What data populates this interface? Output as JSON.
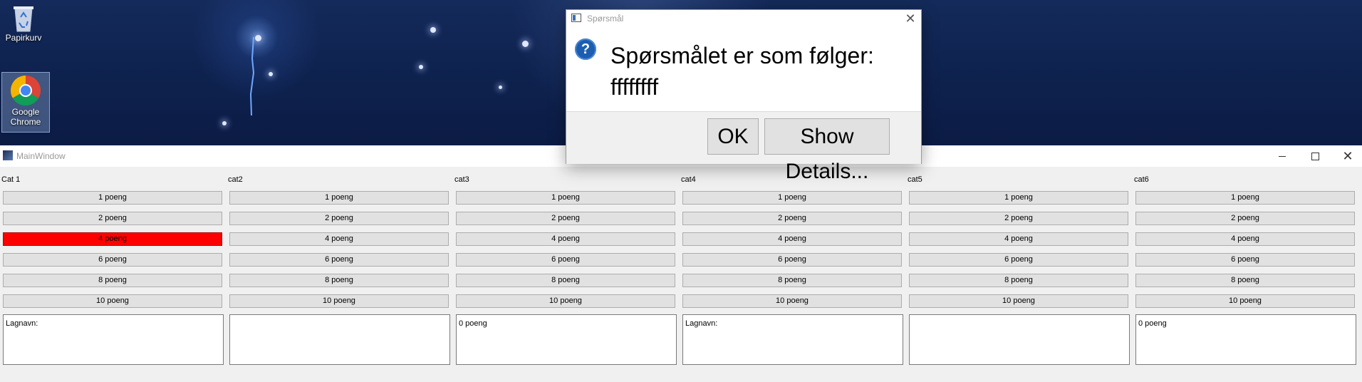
{
  "desktop": {
    "icons": [
      {
        "label": "Papirkurv",
        "icon": "recycle-bin-icon"
      },
      {
        "label": "Google Chrome",
        "icon": "chrome-icon"
      }
    ]
  },
  "window": {
    "title": "MainWindow",
    "categories": [
      {
        "label": "Cat 1",
        "buttons": [
          "1 poeng",
          "2 poeng",
          "4 poeng",
          "6 poeng",
          "8 poeng",
          "10 poeng"
        ],
        "active_index": 2,
        "team_text": "Lagnavn:"
      },
      {
        "label": "cat2",
        "buttons": [
          "1 poeng",
          "2 poeng",
          "4 poeng",
          "6 poeng",
          "8 poeng",
          "10 poeng"
        ],
        "active_index": null,
        "team_text": ""
      },
      {
        "label": "cat3",
        "buttons": [
          "1 poeng",
          "2 poeng",
          "4 poeng",
          "6 poeng",
          "8 poeng",
          "10 poeng"
        ],
        "active_index": null,
        "team_text": "0 poeng"
      },
      {
        "label": "cat4",
        "buttons": [
          "1 poeng",
          "2 poeng",
          "4 poeng",
          "6 poeng",
          "8 poeng",
          "10 poeng"
        ],
        "active_index": null,
        "team_text": "Lagnavn:"
      },
      {
        "label": "cat5",
        "buttons": [
          "1 poeng",
          "2 poeng",
          "4 poeng",
          "6 poeng",
          "8 poeng",
          "10 poeng"
        ],
        "active_index": null,
        "team_text": ""
      },
      {
        "label": "cat6",
        "buttons": [
          "1 poeng",
          "2 poeng",
          "4 poeng",
          "6 poeng",
          "8 poeng",
          "10 poeng"
        ],
        "active_index": null,
        "team_text": "0 poeng"
      }
    ]
  },
  "dialog": {
    "title": "Spørsmål",
    "icon": "question-icon",
    "message_line1": "Spørsmålet er som følger:",
    "message_line2": "ffffffff",
    "ok_label": "OK",
    "details_label": "Show Details..."
  },
  "colors": {
    "active_button": "#ff0000",
    "button_face": "#e1e1e1",
    "window_bg": "#f0f0f0"
  }
}
